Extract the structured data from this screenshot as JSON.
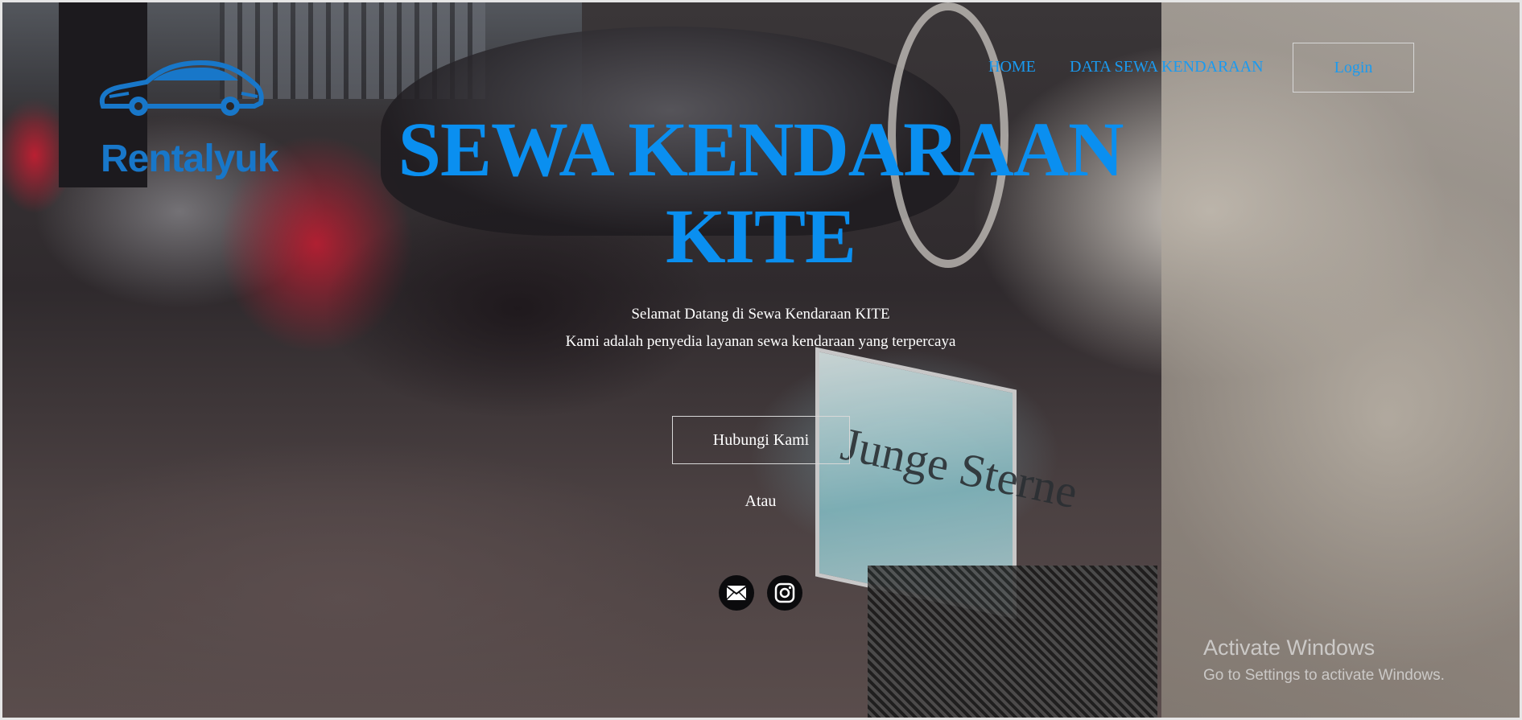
{
  "brand": {
    "name": "Rentalyuk"
  },
  "nav": {
    "home": "HOME",
    "data": "DATA SEWA KENDARAAN",
    "login": "Login"
  },
  "hero": {
    "title": "SEWA KENDARAAN KITE",
    "subtitle_1": "Selamat Datang di Sewa Kendaraan KITE",
    "subtitle_2": "Kami adalah penyedia layanan sewa kendaraan yang terpercaya",
    "cta": "Hubungi Kami",
    "or": "Atau"
  },
  "social": {
    "email_icon": "envelope-icon",
    "instagram_icon": "instagram-icon"
  },
  "background": {
    "plate_text": "Junge Sterne"
  },
  "watermark": {
    "title": "Activate Windows",
    "subtitle": "Go to Settings to activate Windows."
  },
  "colors": {
    "accent": "#0a8ff0",
    "link": "#1a9af0",
    "logo": "#1877c9"
  }
}
